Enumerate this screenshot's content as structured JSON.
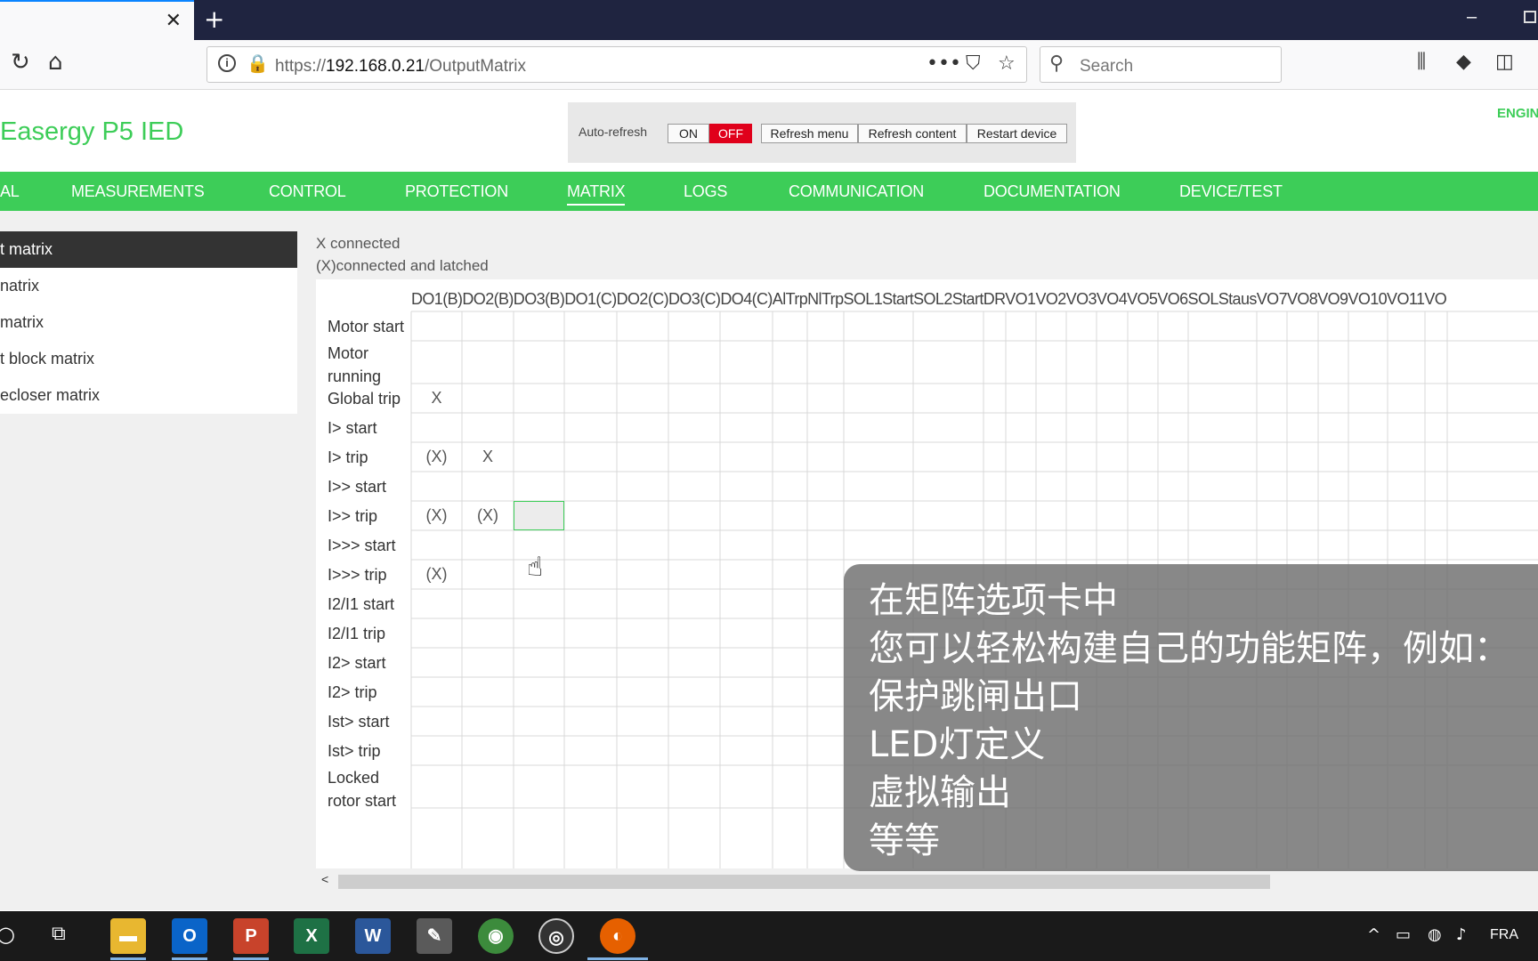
{
  "browser": {
    "tab_close": "✕",
    "new_tab": "+",
    "url_prefix": "https://",
    "url_host": "192.168.0.21",
    "url_path": "/OutputMatrix",
    "search_placeholder": "Search"
  },
  "app": {
    "title": "Easergy P5 IED",
    "corner_label": "ENGIN"
  },
  "refresh_panel": {
    "auto_label": "Auto-refresh",
    "on_label": "ON",
    "off_label": "OFF",
    "refresh_menu": "Refresh menu",
    "refresh_content": "Refresh content",
    "restart_device": "Restart device",
    "state": "OFF"
  },
  "menu": {
    "items": [
      "AL",
      "MEASUREMENTS",
      "CONTROL",
      "PROTECTION",
      "MATRIX",
      "LOGS",
      "COMMUNICATION",
      "DOCUMENTATION",
      "DEVICE/TEST"
    ],
    "active": "MATRIX"
  },
  "sidebar": {
    "items": [
      "t matrix",
      "natrix",
      "matrix",
      "t block matrix",
      "ecloser matrix"
    ]
  },
  "legend": {
    "connected": "X connected",
    "latched": "(X)connected and latched"
  },
  "matrix": {
    "column_headers": [
      "DO1(B)",
      "DO2(B)",
      "DO3(B)",
      "DO1(C)",
      "DO2(C)",
      "DO3(C)",
      "DO4(C)",
      "AlTrp",
      "NlTrp",
      "SOL1Start",
      "SOL2Start",
      "DR",
      "VO1",
      "VO2",
      "VO3",
      "VO4",
      "VO5",
      "VO6",
      "SOLStaus",
      "VO7",
      "VO8",
      "VO9",
      "VO10",
      "VO11",
      "VO"
    ],
    "rows": [
      {
        "label": "Motor start",
        "cells": [
          "",
          ""
        ]
      },
      {
        "label": "Motor running",
        "cells": [
          "",
          ""
        ]
      },
      {
        "label": "Global trip",
        "cells": [
          "X",
          ""
        ]
      },
      {
        "label": "I> start",
        "cells": [
          "",
          ""
        ]
      },
      {
        "label": "I> trip",
        "cells": [
          "(X)",
          "X"
        ]
      },
      {
        "label": "I>> start",
        "cells": [
          "",
          ""
        ]
      },
      {
        "label": "I>> trip",
        "cells": [
          "(X)",
          "(X)"
        ]
      },
      {
        "label": "I>>> start",
        "cells": [
          "",
          ""
        ]
      },
      {
        "label": "I>>> trip",
        "cells": [
          "(X)",
          ""
        ]
      },
      {
        "label": "I2/I1 start",
        "cells": [
          "",
          ""
        ]
      },
      {
        "label": "I2/I1 trip",
        "cells": [
          "",
          ""
        ]
      },
      {
        "label": "I2> start",
        "cells": [
          "",
          ""
        ]
      },
      {
        "label": "I2> trip",
        "cells": [
          "",
          ""
        ]
      },
      {
        "label": "Ist> start",
        "cells": [
          "",
          ""
        ]
      },
      {
        "label": "Ist> trip",
        "cells": [
          "",
          ""
        ]
      },
      {
        "label": "Locked rotor start",
        "cells": [
          "",
          ""
        ]
      }
    ]
  },
  "subtitles": {
    "lines": [
      "在矩阵选项卡中",
      "您可以轻松构建自己的功能矩阵，例如：",
      "保护跳闸出口",
      "LED灯定义",
      "虚拟输出",
      "等等"
    ]
  },
  "taskbar": {
    "language": "FRA"
  },
  "colors": {
    "brand_green": "#3dcd58",
    "off_red": "#e0001b",
    "tabbar": "#1f2440"
  }
}
